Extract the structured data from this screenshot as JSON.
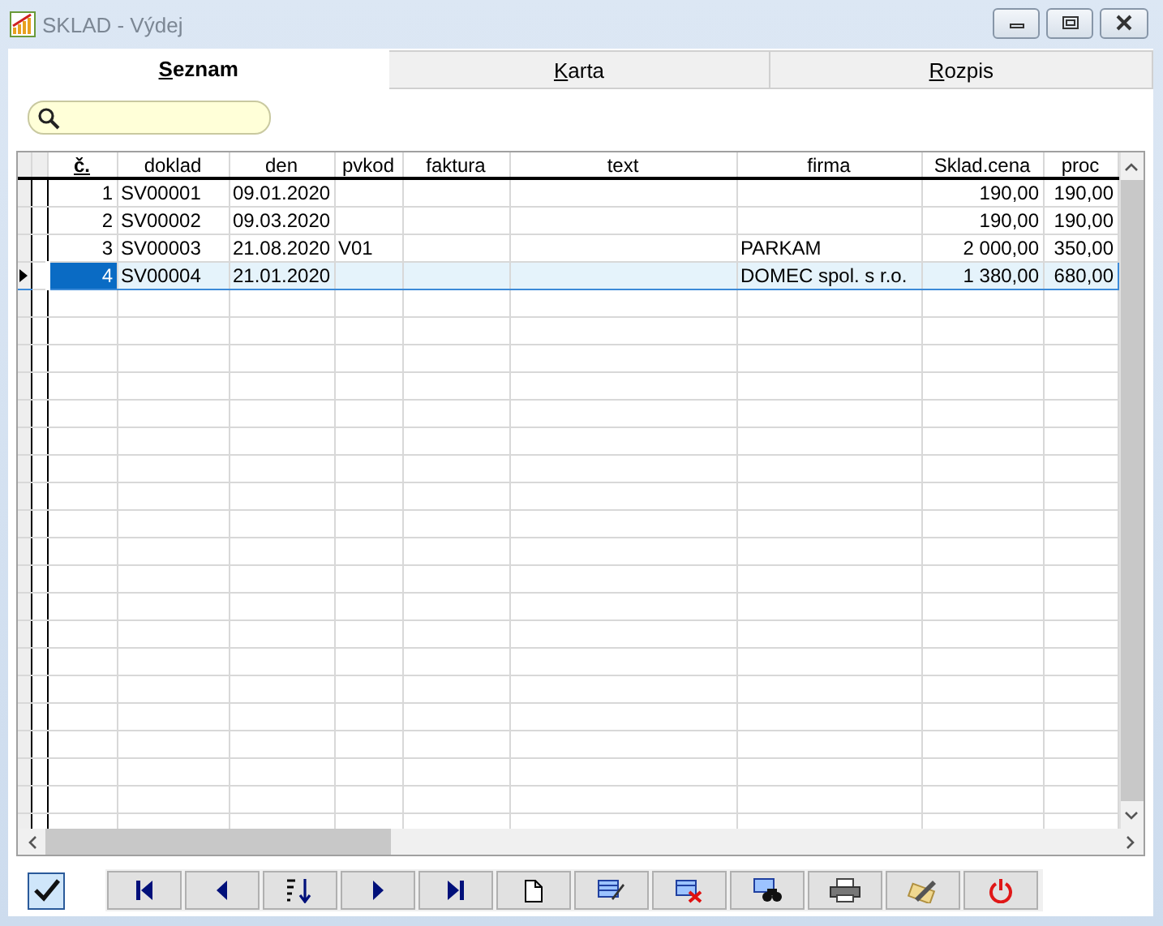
{
  "window": {
    "title": "SKLAD - Výdej"
  },
  "tabs": [
    {
      "label": "Seznam",
      "selected": true
    },
    {
      "label": "Karta",
      "selected": false
    },
    {
      "label": "Rozpis",
      "selected": false
    }
  ],
  "table": {
    "columns": [
      {
        "label": "č.",
        "kind": "num",
        "sorted": true
      },
      {
        "label": "doklad",
        "kind": "text",
        "sorted": false
      },
      {
        "label": "den",
        "kind": "text",
        "sorted": false
      },
      {
        "label": "pvkod",
        "kind": "text",
        "sorted": false
      },
      {
        "label": "faktura",
        "kind": "text",
        "sorted": false
      },
      {
        "label": "text",
        "kind": "text",
        "sorted": false
      },
      {
        "label": "firma",
        "kind": "text",
        "sorted": false
      },
      {
        "label": "Sklad.cena",
        "kind": "num",
        "sorted": false
      },
      {
        "label": "proc",
        "kind": "num",
        "sorted": false
      }
    ],
    "rows": [
      {
        "cells": [
          "1",
          "SV00001",
          "09.01.2020",
          "",
          "",
          "",
          "",
          "190,00",
          "190,00"
        ],
        "selected": false
      },
      {
        "cells": [
          "2",
          "SV00002",
          "09.03.2020",
          "",
          "",
          "",
          "",
          "190,00",
          "190,00"
        ],
        "selected": false
      },
      {
        "cells": [
          "3",
          "SV00003",
          "21.08.2020",
          "V01",
          "",
          "",
          "PARKAM",
          "2 000,00",
          "350,00"
        ],
        "selected": false
      },
      {
        "cells": [
          "4",
          "SV00004",
          "21.01.2020",
          "",
          "",
          "",
          "DOMEC spol. s r.o.",
          "1 380,00",
          "680,00"
        ],
        "selected": true
      }
    ]
  },
  "confirm": {
    "checked": true
  },
  "toolbar": [
    {
      "kind": "first"
    },
    {
      "kind": "prev"
    },
    {
      "kind": "sort"
    },
    {
      "kind": "next"
    },
    {
      "kind": "last"
    },
    {
      "kind": "new"
    },
    {
      "kind": "edit"
    },
    {
      "kind": "delete"
    },
    {
      "kind": "find"
    },
    {
      "kind": "print"
    },
    {
      "kind": "tools"
    },
    {
      "kind": "power"
    }
  ]
}
